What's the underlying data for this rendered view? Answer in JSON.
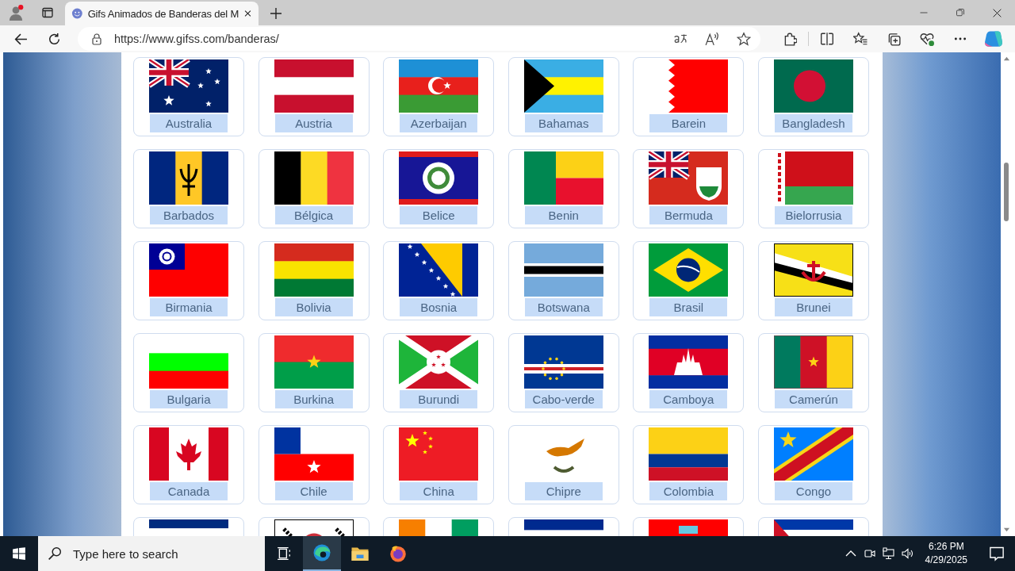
{
  "browser": {
    "tab": {
      "title": "Gifs Animados de Banderas del M",
      "selected": true
    },
    "address": "https://www.gifss.com/banderas/"
  },
  "cards": [
    {
      "kind": "full",
      "label": "Australia"
    },
    {
      "kind": "full",
      "label": "Austria"
    },
    {
      "kind": "full",
      "label": "Azerbaijan"
    },
    {
      "kind": "full",
      "label": "Bahamas"
    },
    {
      "kind": "full",
      "label": "Barein"
    },
    {
      "kind": "full",
      "label": "Bangladesh"
    },
    {
      "kind": "full",
      "label": "Barbados"
    },
    {
      "kind": "full",
      "label": "Bélgica"
    },
    {
      "kind": "full",
      "label": "Belice"
    },
    {
      "kind": "full",
      "label": "Benin"
    },
    {
      "kind": "full",
      "label": "Bermuda"
    },
    {
      "kind": "full",
      "label": "Bielorrusia"
    },
    {
      "kind": "full",
      "label": "Birmania"
    },
    {
      "kind": "full",
      "label": "Bolivia"
    },
    {
      "kind": "full",
      "label": "Bosnia"
    },
    {
      "kind": "full",
      "label": "Botswana"
    },
    {
      "kind": "full",
      "label": "Brasil"
    },
    {
      "kind": "full",
      "label": "Brunei"
    },
    {
      "kind": "full",
      "label": "Bulgaria"
    },
    {
      "kind": "full",
      "label": "Burkina"
    },
    {
      "kind": "full",
      "label": "Burundi"
    },
    {
      "kind": "full",
      "label": "Cabo-verde"
    },
    {
      "kind": "full",
      "label": "Camboya"
    },
    {
      "kind": "full",
      "label": "Camerún"
    },
    {
      "kind": "full",
      "label": "Canada"
    },
    {
      "kind": "full",
      "label": "Chile"
    },
    {
      "kind": "full",
      "label": "China"
    },
    {
      "kind": "full",
      "label": "Chipre"
    },
    {
      "kind": "full",
      "label": "Colombia"
    },
    {
      "kind": "full",
      "label": "Congo"
    },
    {
      "kind": "cut"
    },
    {
      "kind": "cut"
    },
    {
      "kind": "cut"
    },
    {
      "kind": "cut"
    },
    {
      "kind": "cut"
    },
    {
      "kind": "cut"
    }
  ],
  "taskbar": {
    "search_placeholder": "Type here to search",
    "time": "6:26 PM",
    "date": "4/29/2025"
  }
}
